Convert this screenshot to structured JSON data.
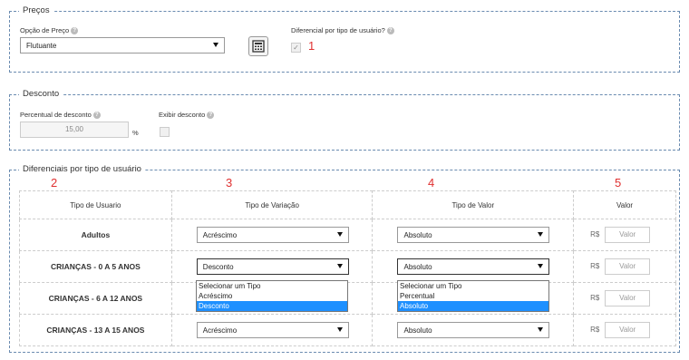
{
  "precos": {
    "legend": "Preços",
    "opcao_label": "Opção de Preço",
    "opcao_value": "Flutuante",
    "diferencial_label": "Diferencial por tipo de usuário?",
    "annotation": "1"
  },
  "desconto": {
    "legend": "Desconto",
    "percentual_label": "Percentual de desconto",
    "percentual_value": "15,00",
    "percent_sign": "%",
    "exibir_label": "Exibir desconto"
  },
  "diferenciais": {
    "legend": "Diferenciais por tipo de usuário",
    "annotations": [
      "2",
      "3",
      "4",
      "5"
    ],
    "headers": [
      "Tipo de Usuario",
      "Tipo de Variação",
      "Tipo de Valor",
      "Valor"
    ],
    "rows": [
      {
        "name": "Adultos",
        "variacao": "Acréscimo",
        "valor_tipo": "Absoluto",
        "currency": "R$",
        "valor_placeholder": "Valor"
      },
      {
        "name": "CRIANÇAS - 0 A 5 ANOS",
        "variacao": "Desconto",
        "valor_tipo": "Absoluto",
        "currency": "R$",
        "valor_placeholder": "Valor"
      },
      {
        "name": "CRIANÇAS - 6 A 12 ANOS",
        "variacao": "",
        "valor_tipo": "",
        "currency": "R$",
        "valor_placeholder": "Valor"
      },
      {
        "name": "CRIANÇAS - 13 A 15 ANOS",
        "variacao": "Acréscimo",
        "valor_tipo": "Absoluto",
        "currency": "R$",
        "valor_placeholder": "Valor"
      }
    ],
    "variacao_options": [
      "Selecionar um Tipo",
      "Acréscimo",
      "Desconto"
    ],
    "variacao_selected": "Desconto",
    "valor_tipo_options": [
      "Selecionar um Tipo",
      "Percentual",
      "Absoluto"
    ],
    "valor_tipo_selected": "Absoluto"
  },
  "colors": {
    "border": "#6a8bb0",
    "highlight": "#1e90ff",
    "annotation": "#e03030"
  }
}
